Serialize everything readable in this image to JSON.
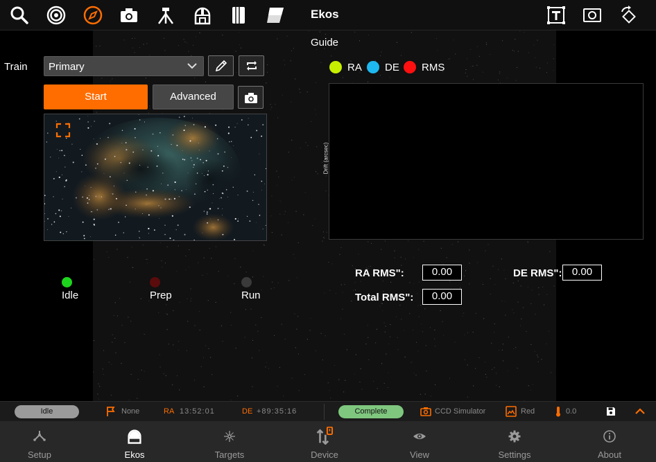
{
  "app": {
    "title": "Ekos"
  },
  "toolbar": {
    "left_icons": [
      "search-icon",
      "target-icon",
      "compass-icon",
      "camera-icon",
      "tripod-icon",
      "observatory-icon",
      "logbook-icon",
      "flat-panel-icon"
    ],
    "right_icons": [
      "text-overlay-icon",
      "screenshot-icon",
      "rotate-icon"
    ],
    "active_icon": "compass-icon"
  },
  "train": {
    "label": "Train",
    "selected": "Primary",
    "options": [
      "Primary"
    ]
  },
  "actions": {
    "start_label": "Start",
    "advanced_label": "Advanced"
  },
  "stages": [
    {
      "label": "Idle",
      "color": "#1ed51e"
    },
    {
      "label": "Prep",
      "color": "#5a0b0b"
    },
    {
      "label": "Run",
      "color": "#3a3a3a"
    }
  ],
  "guide": {
    "title": "Guide",
    "legend": [
      {
        "label": "RA",
        "color": "#c7f000"
      },
      {
        "label": "DE",
        "color": "#1eb8f0"
      },
      {
        "label": "RMS",
        "color": "#ff1010"
      }
    ],
    "ylabel": "Drift (arcsec)",
    "ra_rms_label": "RA RMS\":",
    "ra_rms": "0.00",
    "de_rms_label": "DE RMS\":",
    "de_rms": "0.00",
    "total_rms_label": "Total RMS\":",
    "total_rms": "0.00"
  },
  "statusbar": {
    "left_pill": "Idle",
    "target": "None",
    "ra_key": "RA",
    "ra_value": "13:52:01",
    "de_key": "DE",
    "de_value": "+89:35:16",
    "right_pill": "Complete",
    "camera": "CCD Simulator",
    "filter": "Red",
    "temperature": "0.0"
  },
  "colors": {
    "accent": "#ff6d00",
    "pill_idle": "#9b9b9b",
    "pill_complete": "#7fc77f"
  },
  "nav": [
    {
      "label": "Setup",
      "icon": "setup-icon"
    },
    {
      "label": "Ekos",
      "icon": "ekos-icon"
    },
    {
      "label": "Targets",
      "icon": "targets-icon"
    },
    {
      "label": "Device",
      "icon": "device-icon"
    },
    {
      "label": "View",
      "icon": "view-icon"
    },
    {
      "label": "Settings",
      "icon": "settings-icon"
    },
    {
      "label": "About",
      "icon": "about-icon"
    }
  ],
  "nav_active": "Ekos"
}
